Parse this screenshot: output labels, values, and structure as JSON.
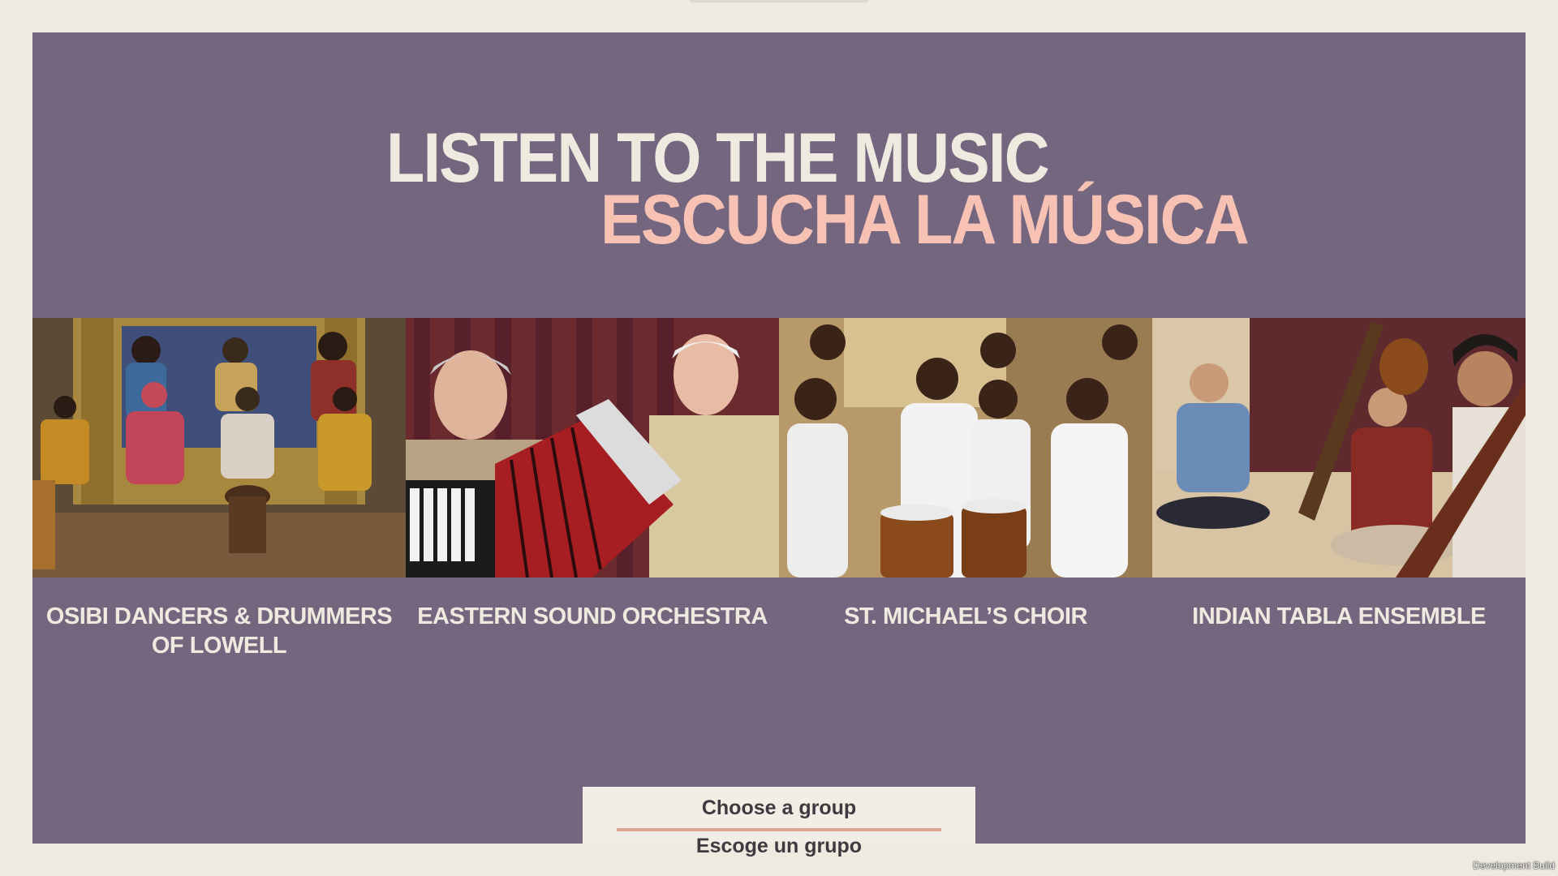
{
  "header": {
    "title_en": "LISTEN TO THE MUSIC",
    "title_es": "ESCUCHA LA MÚSICA"
  },
  "groups": [
    {
      "name": "OSIBI DANCERS & DRUMMERS\nOF LOWELL",
      "photo_icon": "drummers-photo"
    },
    {
      "name": "EASTERN SOUND ORCHESTRA",
      "photo_icon": "accordion-photo"
    },
    {
      "name": "ST. MICHAEL’S CHOIR",
      "photo_icon": "choir-photo"
    },
    {
      "name": "INDIAN TABLA ENSEMBLE",
      "photo_icon": "sitar-photo"
    }
  ],
  "chooser": {
    "label_en": "Choose a group",
    "label_es": "Escoge un grupo"
  },
  "footer": {
    "build_label": "Development Build"
  },
  "colors": {
    "panel": "#74667f",
    "background": "#eeeae0",
    "title_en": "#efeadf",
    "title_es": "#f7c2b4",
    "accent": "#e0a596"
  }
}
